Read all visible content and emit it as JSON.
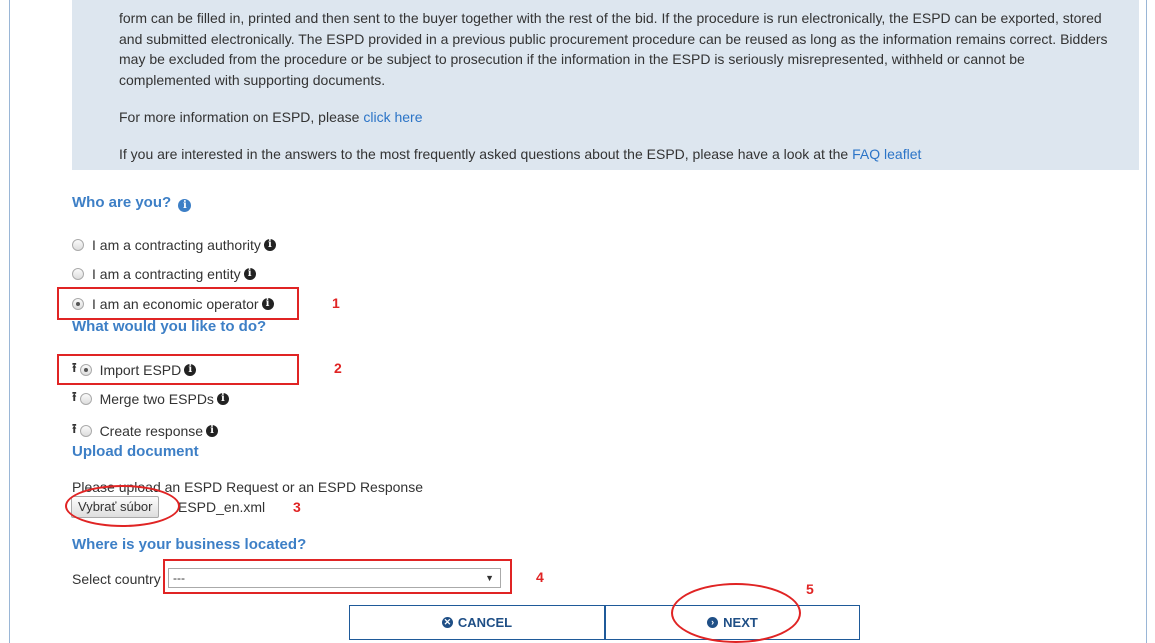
{
  "intro": {
    "paragraph1": "form can be filled in, printed and then sent to the buyer together with the rest of the bid. If the procedure is run electronically, the ESPD can be exported, stored and submitted electronically. The ESPD provided in a previous public procurement procedure can be reused as long as the information remains correct. Bidders may be excluded from the procedure or be subject to prosecution if the information in the ESPD is seriously misrepresented, withheld or cannot be complemented with supporting documents.",
    "more_info_text": "For more information on ESPD, please ",
    "more_info_link": "click here",
    "faq_text": "If you are interested in the answers to the most frequently asked questions about the ESPD, please have a look at the ",
    "faq_link": "FAQ leaflet"
  },
  "who": {
    "heading": "Who are you?",
    "options": [
      {
        "label": "I am a contracting authority",
        "selected": false
      },
      {
        "label": "I am a contracting entity",
        "selected": false
      },
      {
        "label": "I am an economic operator",
        "selected": true
      }
    ]
  },
  "what": {
    "heading": "What would you like to do?",
    "options": [
      {
        "label": "Import ESPD",
        "selected": true
      },
      {
        "label": "Merge two ESPDs",
        "selected": false
      },
      {
        "label": "Create response",
        "selected": false
      }
    ]
  },
  "upload": {
    "heading": "Upload document",
    "instruction": "Please upload an ESPD Request or an ESPD Response",
    "button_label": "Vybrať súbor",
    "file_name": "ESPD_en.xml"
  },
  "location": {
    "heading": "Where is your business located?",
    "label": "Select country",
    "selected": "---"
  },
  "actions": {
    "cancel_label": "CANCEL",
    "next_label": "NEXT"
  },
  "annotations": [
    "1",
    "2",
    "3",
    "4",
    "5"
  ],
  "colors": {
    "heading": "#3d7fc6",
    "link": "#2b74c7",
    "annotation": "#e02424",
    "panel": "#dde6ef"
  }
}
